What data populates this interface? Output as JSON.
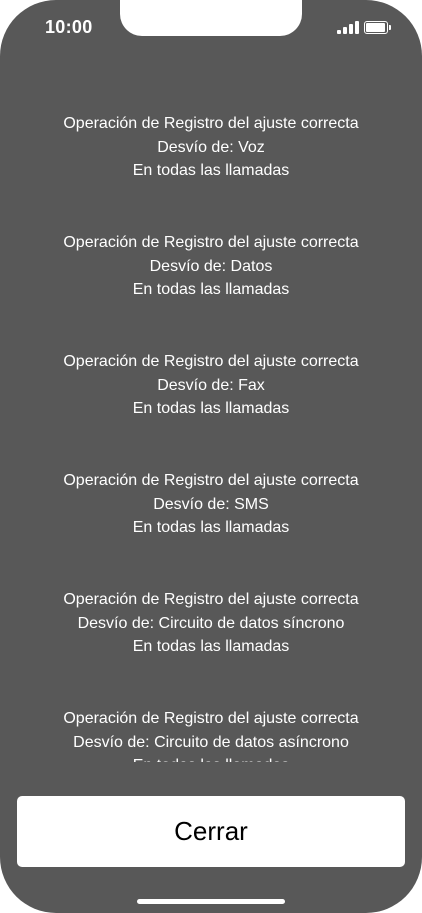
{
  "status_bar": {
    "time": "10:00",
    "signal_icon": "cellular-signal-icon",
    "battery_icon": "battery-icon",
    "battery_level": 1.0
  },
  "results": [
    {
      "line1": "Operación de Registro del ajuste correcta",
      "line2": "Desvío de: Voz",
      "line3": "En todas las llamadas"
    },
    {
      "line1": "Operación de Registro del ajuste correcta",
      "line2": "Desvío de: Datos",
      "line3": "En todas las llamadas"
    },
    {
      "line1": "Operación de Registro del ajuste correcta",
      "line2": "Desvío de: Fax",
      "line3": "En todas las llamadas"
    },
    {
      "line1": "Operación de Registro del ajuste correcta",
      "line2": "Desvío de: SMS",
      "line3": "En todas las llamadas"
    },
    {
      "line1": "Operación de Registro del ajuste correcta",
      "line2": "Desvío de: Circuito de datos síncrono",
      "line3": "En todas las llamadas"
    },
    {
      "line1": "Operación de Registro del ajuste correcta",
      "line2": "Desvío de: Circuito de datos asíncrono",
      "line3": "En todas las llamadas"
    }
  ],
  "close_button": {
    "label": "Cerrar"
  },
  "colors": {
    "background": "#585858",
    "text": "#ffffff",
    "button_background": "#ffffff",
    "button_text": "#000000"
  }
}
